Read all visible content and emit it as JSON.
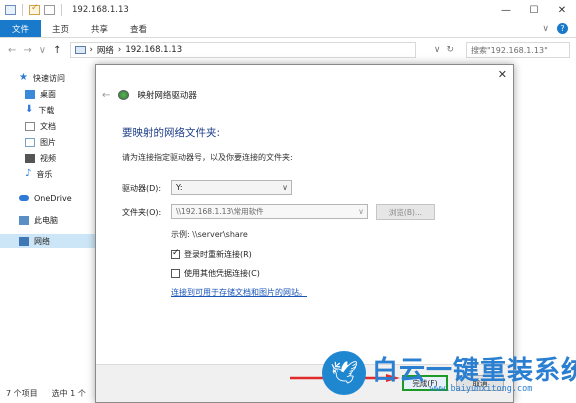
{
  "window": {
    "title": "192.168.1.13",
    "controls": {
      "minimize": "—",
      "maximize": "☐",
      "close": "✕"
    }
  },
  "ribbon": {
    "tabs": [
      {
        "label": "文件",
        "active": true
      },
      {
        "label": "主页",
        "active": false
      },
      {
        "label": "共享",
        "active": false
      },
      {
        "label": "查看",
        "active": false
      }
    ],
    "expand": "∨",
    "help": "?"
  },
  "address": {
    "path": [
      "网络",
      "192.168.1.13"
    ],
    "sep": "›",
    "dropdown": "∨",
    "refresh": "↻",
    "search_placeholder": "搜索\"192.168.1.13\""
  },
  "sidebar": {
    "items": [
      {
        "label": "快速访问",
        "icon": "star-icon"
      },
      {
        "label": "桌面",
        "icon": "desktop-icon"
      },
      {
        "label": "下载",
        "icon": "download-icon"
      },
      {
        "label": "文档",
        "icon": "documents-icon"
      },
      {
        "label": "图片",
        "icon": "pictures-icon"
      },
      {
        "label": "视频",
        "icon": "videos-icon"
      },
      {
        "label": "音乐",
        "icon": "music-icon"
      },
      {
        "label": "OneDrive",
        "icon": "onedrive-icon"
      },
      {
        "label": "此电脑",
        "icon": "this-pc-icon"
      },
      {
        "label": "网络",
        "icon": "network-icon",
        "selected": true
      }
    ]
  },
  "status": {
    "items_count": "7 个项目",
    "selected_count": "选中 1 个"
  },
  "dialog": {
    "title": "映射网络驱动器",
    "heading": "要映射的网络文件夹:",
    "subtitle": "请为连接指定驱动器号，以及你要连接的文件夹:",
    "drive_label": "驱动器(D):",
    "drive_value": "Y:",
    "folder_label": "文件夹(O):",
    "folder_value": "\\\\192.168.1.13\\常用软件",
    "browse_label": "浏览(B)...",
    "example": "示例: \\\\server\\share",
    "reconnect_label": "登录时重新连接(R)",
    "reconnect_checked": true,
    "other_creds_label": "使用其他凭据连接(C)",
    "other_creds_checked": false,
    "link": "连接到可用于存储文档和图片的网站。",
    "finish_label": "完成(F)",
    "cancel_label": "取消",
    "close": "✕"
  },
  "watermark": {
    "text": "白云一键重装系统",
    "url": "www.baiyunxitong.com"
  },
  "colors": {
    "accent": "#1979ca",
    "heading": "#1e3f8a",
    "link": "#1a56b8",
    "finish_border": "#1d9a26",
    "arrow": "#e12b2b"
  }
}
